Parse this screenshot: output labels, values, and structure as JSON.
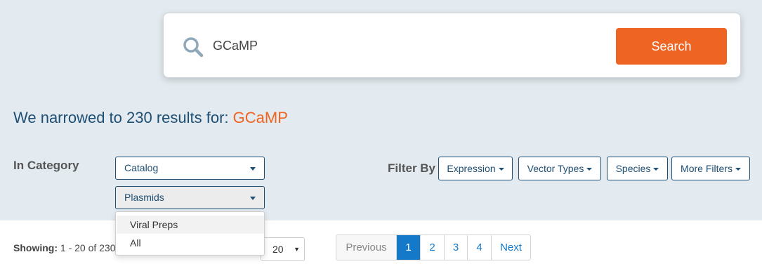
{
  "search": {
    "value": "GCaMP",
    "button_label": "Search"
  },
  "results": {
    "prefix": "We narrowed to 230 results for: ",
    "query": "GCaMP"
  },
  "category": {
    "label": "In Category",
    "primary_selected": "Catalog",
    "secondary_selected": "Plasmids",
    "menu_items": [
      "Viral Preps",
      "All"
    ]
  },
  "filters": {
    "label": "Filter By",
    "buttons": [
      "Expression",
      "Vector Types",
      "Species",
      "More Filters"
    ]
  },
  "showing": {
    "label": "Showing:",
    "range": " 1 - 20 of 230"
  },
  "per_page": {
    "value": "20"
  },
  "pagination": {
    "previous": "Previous",
    "pages": [
      "1",
      "2",
      "3",
      "4"
    ],
    "current": "1",
    "next": "Next"
  },
  "colors": {
    "accent_orange": "#ee6422",
    "primary_blue": "#1d4e73",
    "link_blue": "#1479c9",
    "background": "#e4ebf0"
  }
}
